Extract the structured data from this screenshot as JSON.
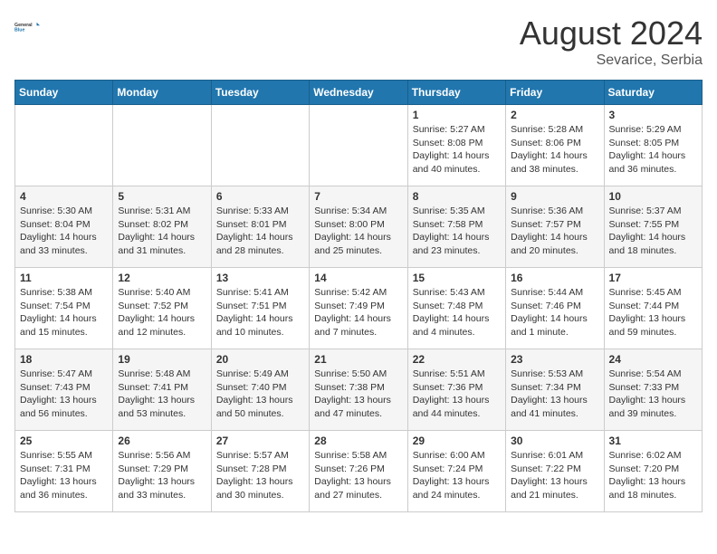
{
  "header": {
    "logo_general": "General",
    "logo_blue": "Blue",
    "month": "August 2024",
    "location": "Sevarice, Serbia"
  },
  "weekdays": [
    "Sunday",
    "Monday",
    "Tuesday",
    "Wednesday",
    "Thursday",
    "Friday",
    "Saturday"
  ],
  "weeks": [
    [
      {
        "day": "",
        "info": ""
      },
      {
        "day": "",
        "info": ""
      },
      {
        "day": "",
        "info": ""
      },
      {
        "day": "",
        "info": ""
      },
      {
        "day": "1",
        "info": "Sunrise: 5:27 AM\nSunset: 8:08 PM\nDaylight: 14 hours\nand 40 minutes."
      },
      {
        "day": "2",
        "info": "Sunrise: 5:28 AM\nSunset: 8:06 PM\nDaylight: 14 hours\nand 38 minutes."
      },
      {
        "day": "3",
        "info": "Sunrise: 5:29 AM\nSunset: 8:05 PM\nDaylight: 14 hours\nand 36 minutes."
      }
    ],
    [
      {
        "day": "4",
        "info": "Sunrise: 5:30 AM\nSunset: 8:04 PM\nDaylight: 14 hours\nand 33 minutes."
      },
      {
        "day": "5",
        "info": "Sunrise: 5:31 AM\nSunset: 8:02 PM\nDaylight: 14 hours\nand 31 minutes."
      },
      {
        "day": "6",
        "info": "Sunrise: 5:33 AM\nSunset: 8:01 PM\nDaylight: 14 hours\nand 28 minutes."
      },
      {
        "day": "7",
        "info": "Sunrise: 5:34 AM\nSunset: 8:00 PM\nDaylight: 14 hours\nand 25 minutes."
      },
      {
        "day": "8",
        "info": "Sunrise: 5:35 AM\nSunset: 7:58 PM\nDaylight: 14 hours\nand 23 minutes."
      },
      {
        "day": "9",
        "info": "Sunrise: 5:36 AM\nSunset: 7:57 PM\nDaylight: 14 hours\nand 20 minutes."
      },
      {
        "day": "10",
        "info": "Sunrise: 5:37 AM\nSunset: 7:55 PM\nDaylight: 14 hours\nand 18 minutes."
      }
    ],
    [
      {
        "day": "11",
        "info": "Sunrise: 5:38 AM\nSunset: 7:54 PM\nDaylight: 14 hours\nand 15 minutes."
      },
      {
        "day": "12",
        "info": "Sunrise: 5:40 AM\nSunset: 7:52 PM\nDaylight: 14 hours\nand 12 minutes."
      },
      {
        "day": "13",
        "info": "Sunrise: 5:41 AM\nSunset: 7:51 PM\nDaylight: 14 hours\nand 10 minutes."
      },
      {
        "day": "14",
        "info": "Sunrise: 5:42 AM\nSunset: 7:49 PM\nDaylight: 14 hours\nand 7 minutes."
      },
      {
        "day": "15",
        "info": "Sunrise: 5:43 AM\nSunset: 7:48 PM\nDaylight: 14 hours\nand 4 minutes."
      },
      {
        "day": "16",
        "info": "Sunrise: 5:44 AM\nSunset: 7:46 PM\nDaylight: 14 hours\nand 1 minute."
      },
      {
        "day": "17",
        "info": "Sunrise: 5:45 AM\nSunset: 7:44 PM\nDaylight: 13 hours\nand 59 minutes."
      }
    ],
    [
      {
        "day": "18",
        "info": "Sunrise: 5:47 AM\nSunset: 7:43 PM\nDaylight: 13 hours\nand 56 minutes."
      },
      {
        "day": "19",
        "info": "Sunrise: 5:48 AM\nSunset: 7:41 PM\nDaylight: 13 hours\nand 53 minutes."
      },
      {
        "day": "20",
        "info": "Sunrise: 5:49 AM\nSunset: 7:40 PM\nDaylight: 13 hours\nand 50 minutes."
      },
      {
        "day": "21",
        "info": "Sunrise: 5:50 AM\nSunset: 7:38 PM\nDaylight: 13 hours\nand 47 minutes."
      },
      {
        "day": "22",
        "info": "Sunrise: 5:51 AM\nSunset: 7:36 PM\nDaylight: 13 hours\nand 44 minutes."
      },
      {
        "day": "23",
        "info": "Sunrise: 5:53 AM\nSunset: 7:34 PM\nDaylight: 13 hours\nand 41 minutes."
      },
      {
        "day": "24",
        "info": "Sunrise: 5:54 AM\nSunset: 7:33 PM\nDaylight: 13 hours\nand 39 minutes."
      }
    ],
    [
      {
        "day": "25",
        "info": "Sunrise: 5:55 AM\nSunset: 7:31 PM\nDaylight: 13 hours\nand 36 minutes."
      },
      {
        "day": "26",
        "info": "Sunrise: 5:56 AM\nSunset: 7:29 PM\nDaylight: 13 hours\nand 33 minutes."
      },
      {
        "day": "27",
        "info": "Sunrise: 5:57 AM\nSunset: 7:28 PM\nDaylight: 13 hours\nand 30 minutes."
      },
      {
        "day": "28",
        "info": "Sunrise: 5:58 AM\nSunset: 7:26 PM\nDaylight: 13 hours\nand 27 minutes."
      },
      {
        "day": "29",
        "info": "Sunrise: 6:00 AM\nSunset: 7:24 PM\nDaylight: 13 hours\nand 24 minutes."
      },
      {
        "day": "30",
        "info": "Sunrise: 6:01 AM\nSunset: 7:22 PM\nDaylight: 13 hours\nand 21 minutes."
      },
      {
        "day": "31",
        "info": "Sunrise: 6:02 AM\nSunset: 7:20 PM\nDaylight: 13 hours\nand 18 minutes."
      }
    ]
  ]
}
